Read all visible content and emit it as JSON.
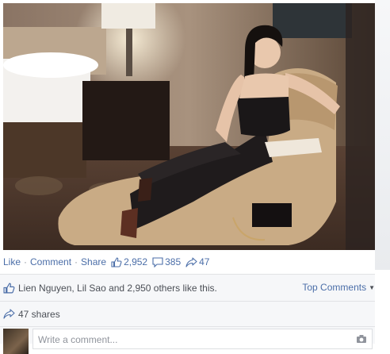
{
  "post": {
    "actions": {
      "like": "Like",
      "comment": "Comment",
      "share": "Share",
      "separator": "·"
    },
    "stats": {
      "likes": "2,952",
      "comments": "385",
      "shares": "47"
    }
  },
  "ufi": {
    "likes_summary": "Lien Nguyen, Lil Sao and 2,950 others like this.",
    "top_comments": "Top Comments",
    "shares_summary": "47 shares",
    "comment_placeholder": "Write a comment..."
  },
  "icons": {
    "like": "thumbs-up-icon",
    "comment": "speech-bubble-icon",
    "share": "share-arrow-icon",
    "camera": "camera-icon",
    "caret": "caret-down-icon"
  },
  "colors": {
    "link": "#4b6ea8",
    "text": "#4b4f56",
    "muted": "#90949c",
    "ufi_background": "#f6f7f9",
    "border": "#e1e2e5"
  }
}
